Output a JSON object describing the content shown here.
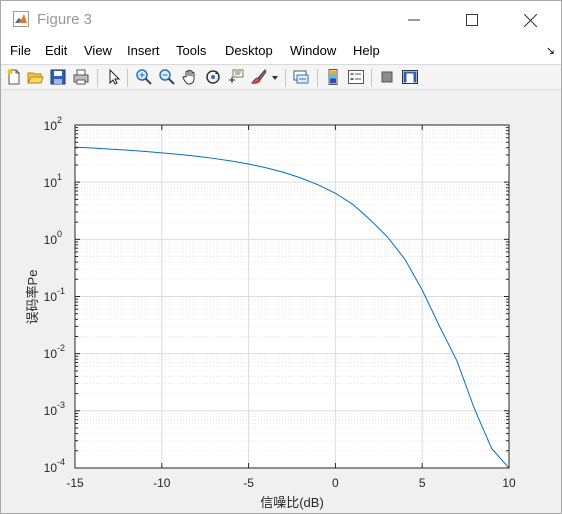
{
  "window": {
    "title": "Figure 3",
    "icon": "matlab-logo-icon"
  },
  "menu": {
    "items": [
      "File",
      "Edit",
      "View",
      "Insert",
      "Tools",
      "Desktop",
      "Window",
      "Help"
    ],
    "overflow_icon": "dock-arrow-icon"
  },
  "toolbar": {
    "buttons": [
      "new-figure-icon",
      "open-file-icon",
      "save-icon",
      "print-icon",
      "edit-plot-arrow-icon",
      "zoom-in-icon",
      "zoom-out-icon",
      "pan-hand-icon",
      "rotate-3d-icon",
      "data-cursor-icon",
      "brush-icon",
      "brush-dropdown-icon",
      "link-plot-icon",
      "insert-colorbar-icon",
      "insert-legend-icon",
      "hide-plot-tools-icon",
      "show-plot-tools-icon"
    ]
  },
  "chart_data": {
    "type": "line",
    "title": "",
    "xlabel": "信噪比(dB)",
    "ylabel": "误码率Pe",
    "xlim": [
      -15,
      10
    ],
    "ylim": [
      0.0001,
      100
    ],
    "yscale": "log",
    "grid": true,
    "minor_grid": true,
    "x_ticks": [
      "-15",
      "-10",
      "-5",
      "0",
      "5",
      "10"
    ],
    "y_ticks": [
      {
        "base": "10",
        "exp": "-4"
      },
      {
        "base": "10",
        "exp": "-3"
      },
      {
        "base": "10",
        "exp": "-2"
      },
      {
        "base": "10",
        "exp": "-1"
      },
      {
        "base": "10",
        "exp": "0"
      },
      {
        "base": "10",
        "exp": "1"
      },
      {
        "base": "10",
        "exp": "2"
      }
    ],
    "series": [
      {
        "color": "#0072bd",
        "x": [
          -15,
          -14,
          -13,
          -12,
          -11,
          -10,
          -9,
          -8,
          -7,
          -6,
          -5,
          -4,
          -3,
          -2,
          -1,
          0,
          1,
          2,
          3,
          4,
          5,
          6,
          7,
          8,
          9,
          10
        ],
        "y": [
          41,
          39.5,
          37.9,
          36.3,
          34.5,
          32.6,
          30.6,
          28.4,
          26.0,
          23.5,
          20.8,
          17.9,
          14.9,
          11.9,
          9.0,
          6.4,
          4.1,
          2.2,
          1.1,
          0.45,
          0.13,
          0.03,
          0.0075,
          0.0011,
          0.00022,
          6e-05
        ]
      }
    ]
  }
}
